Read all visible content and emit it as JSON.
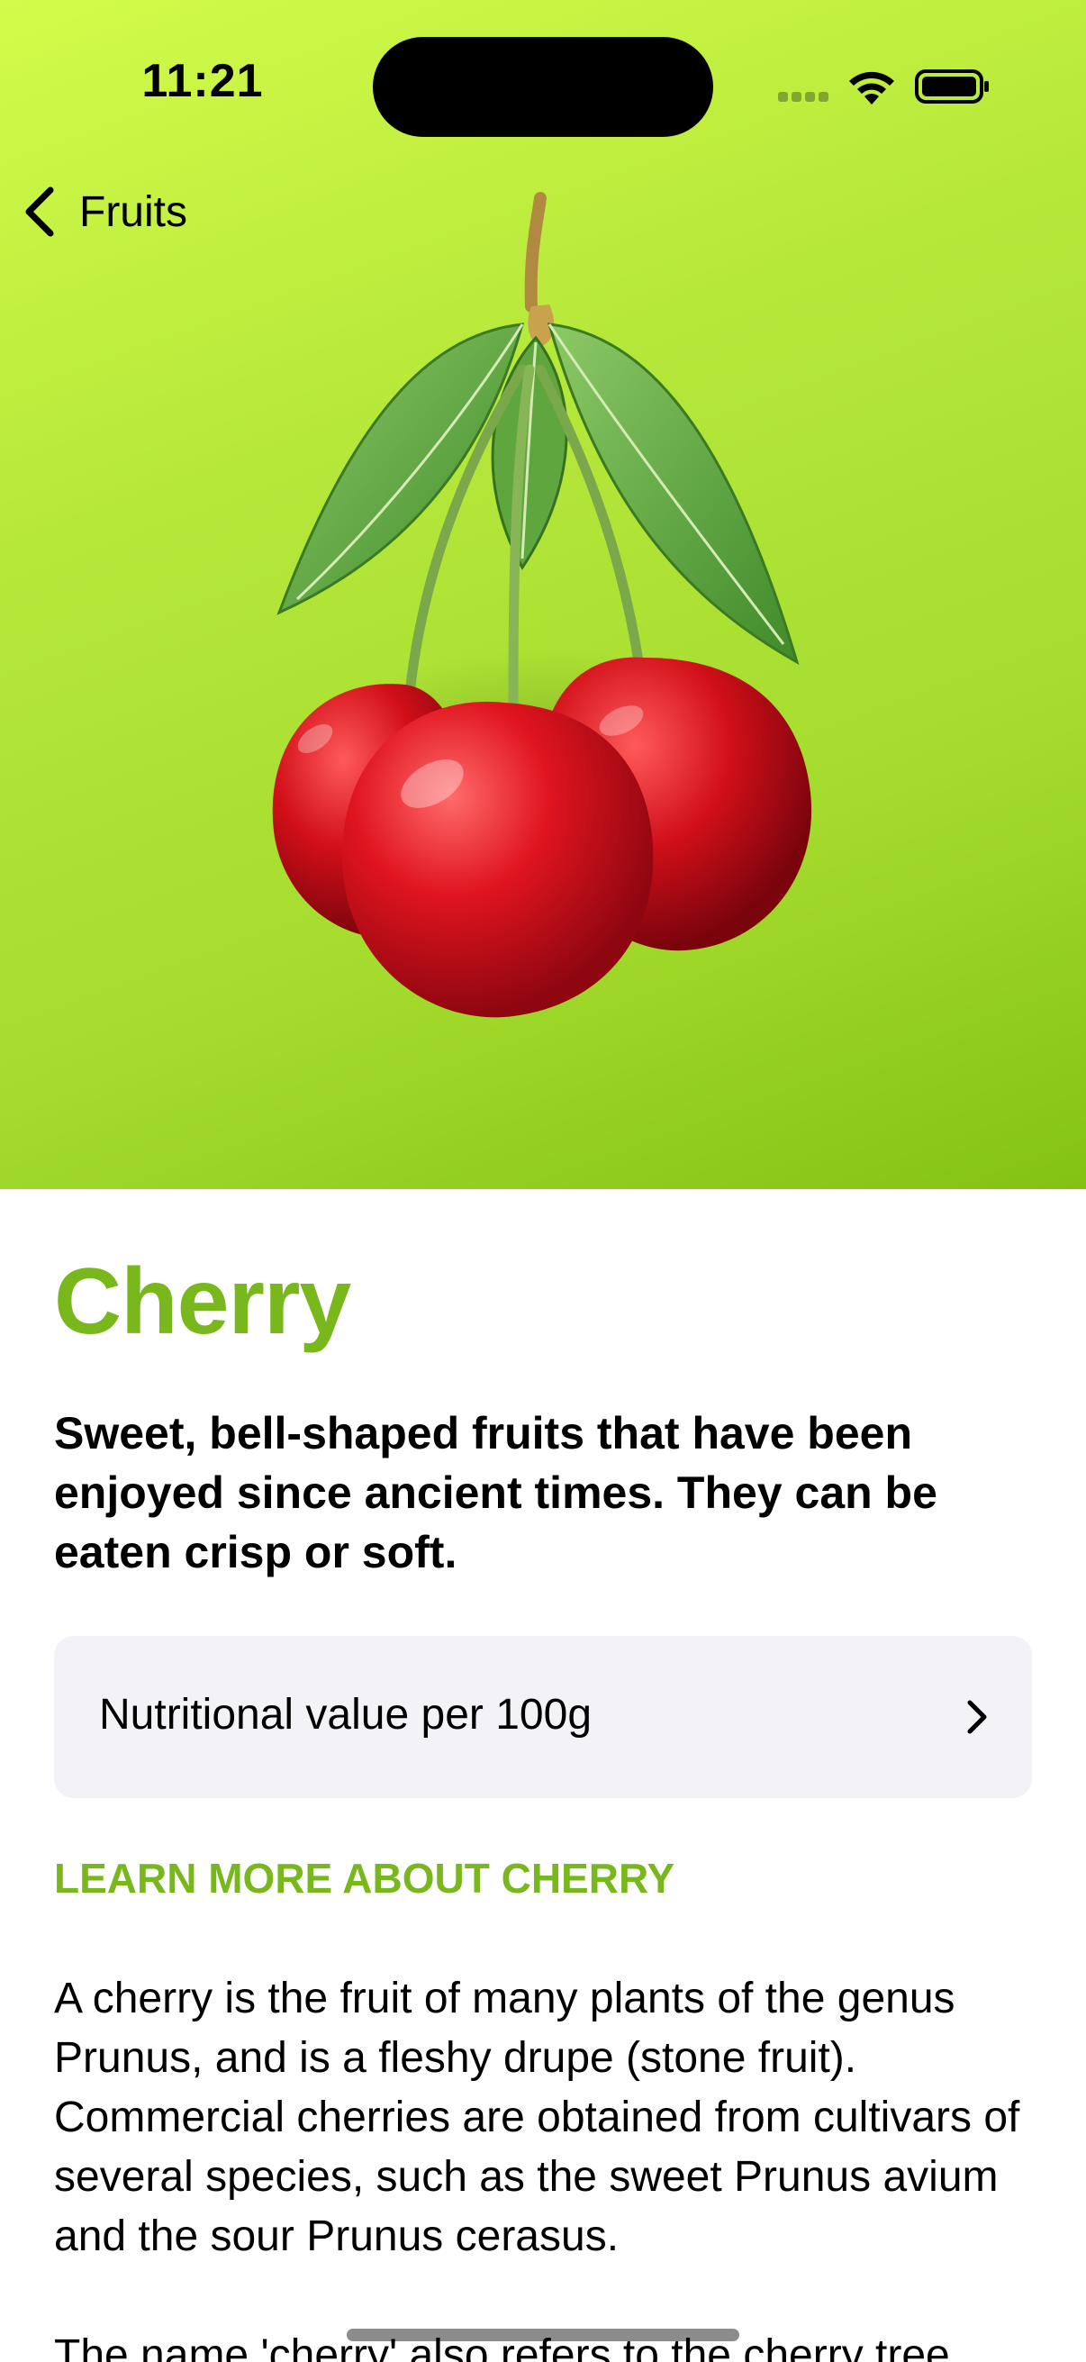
{
  "status_bar": {
    "time": "11:21"
  },
  "nav": {
    "back_label": "Fruits"
  },
  "fruit": {
    "name": "Cherry",
    "headline": "Sweet, bell-shaped fruits that have been enjoyed since ancient times. They can be eaten crisp or soft.",
    "nutrition_label": "Nutritional value per 100g",
    "learn_more_heading": "LEARN MORE ABOUT CHERRY",
    "description": [
      "A cherry is the fruit of many plants of the genus Prunus, and is a fleshy drupe (stone fruit). Commercial cherries are obtained from cultivars of several species, such as the sweet Prunus avium and the sour Prunus cerasus.",
      "The name 'cherry' also refers to the cherry tree"
    ]
  },
  "icons": {
    "back": "chevron-left-icon",
    "disclosure": "chevron-right-icon",
    "wifi": "wifi-icon",
    "battery": "battery-icon",
    "signal": "cellular-signal-icon"
  },
  "colors": {
    "accent": "#78b81c",
    "hero_gradient_start": "#d3fb4a",
    "hero_gradient_end": "#84c212",
    "row_background": "#f2f2f7"
  }
}
